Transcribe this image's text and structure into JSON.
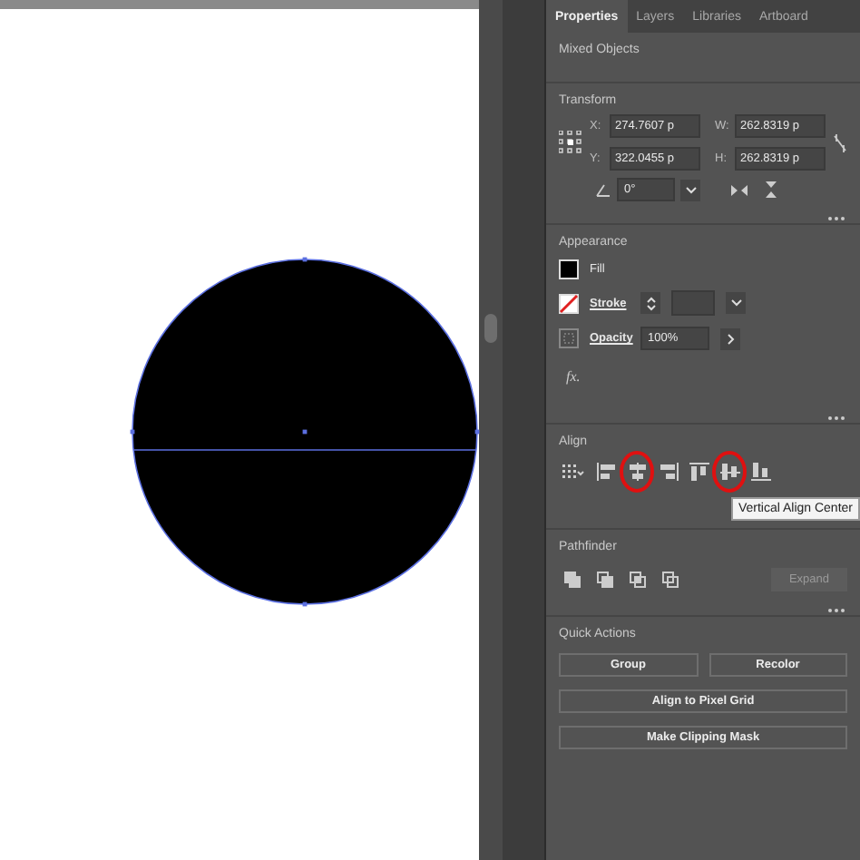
{
  "tabs": [
    {
      "label": "Properties",
      "selected": true
    },
    {
      "label": "Layers",
      "selected": false
    },
    {
      "label": "Libraries",
      "selected": false
    },
    {
      "label": "Artboard",
      "selected": false
    }
  ],
  "selection_label": "Mixed Objects",
  "transform": {
    "title": "Transform",
    "fields": [
      {
        "label": "X:",
        "value": "274.7607 p"
      },
      {
        "label": "W:",
        "value": "262.8319 p"
      },
      {
        "label": "Y:",
        "value": "322.0455 p"
      },
      {
        "label": "H:",
        "value": "262.8319 p"
      }
    ],
    "angle": "0°"
  },
  "appearance": {
    "title": "Appearance",
    "rows": [
      {
        "kind": "fill",
        "label": "Fill"
      },
      {
        "kind": "stroke",
        "label": "Stroke"
      },
      {
        "kind": "opacity",
        "label": "Opacity",
        "value": "100%"
      }
    ],
    "fx": "fx."
  },
  "align": {
    "title": "Align",
    "buttons": [
      {
        "kind": "distribute",
        "circled": false
      },
      {
        "kind": "left",
        "circled": false
      },
      {
        "kind": "hcenter",
        "circled": true
      },
      {
        "kind": "right",
        "circled": false
      },
      {
        "kind": "top",
        "circled": false
      },
      {
        "kind": "vcenter",
        "circled": true
      },
      {
        "kind": "bottom",
        "circled": false
      }
    ],
    "tooltip": "Vertical Align Center"
  },
  "pathfinder": {
    "title": "Pathfinder",
    "expand": {
      "label": "Expand",
      "disabled": true
    }
  },
  "quick_actions": {
    "title": "Quick Actions",
    "rows": [
      [
        "Group",
        "Recolor"
      ],
      [
        "Align to Pixel Grid"
      ],
      [
        "Make Clipping Mask"
      ]
    ]
  }
}
